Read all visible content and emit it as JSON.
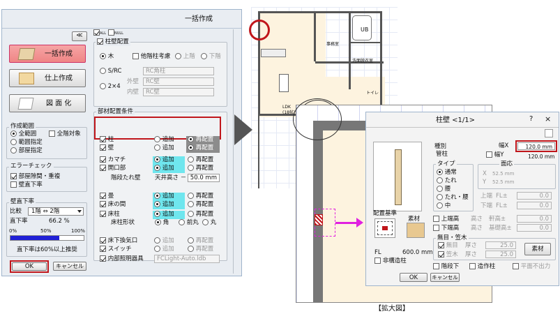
{
  "left": {
    "title": "一括作成",
    "collapse": "≪",
    "modes": [
      "一括作成",
      "仕上作成",
      "図 面 化"
    ],
    "tb_all": "ALL",
    "tb_none": "NULL",
    "range": {
      "title": "作成範囲",
      "all": "全範囲",
      "all_target": "全階対象",
      "area": "範囲指定",
      "floor": "部屋指定"
    },
    "error": {
      "title": "エラーチェック",
      "room": "部屋隙間・重複",
      "wall": "壁直下率"
    },
    "wall_rate": {
      "title": "壁直下率",
      "compare": "比較",
      "floor_pair": "1階 ⇔ 2階",
      "rate_label": "直下率",
      "rate_value": "66.2 %",
      "p0": "0%",
      "p50": "50%",
      "p100": "100%",
      "note": "直下率は60%以上推奨"
    },
    "ok": "OK",
    "cancel": "キャンセル",
    "pillar": {
      "title": "柱壁配置",
      "wood": "木",
      "srcc": "S/RC",
      "x24": "2×4",
      "other": "他階柱考慮",
      "up": "上階",
      "down": "下階",
      "srcc_sel": "RC角柱",
      "outer": "外壁",
      "outer_sel": "RC壁",
      "inner": "内壁",
      "inner_sel": "RC壁"
    },
    "parts": {
      "title": "部材配置条件",
      "add": "追加",
      "re": "再配置",
      "rows": [
        "柱",
        "壁",
        "カマチ",
        "開口部",
        "階段たれ壁",
        "畳",
        "床の間",
        "床柱",
        "床柱形状",
        "床下換気口",
        "スイッチ",
        "内部照明器具"
      ],
      "ceiling": "天井高さ －",
      "ceiling_val": "50.0 mm",
      "shape": [
        "角",
        "前丸",
        "丸"
      ],
      "light_sel": "FCLight-Auto.ldb"
    }
  },
  "plan": {
    "room_ub": "UB",
    "room_office": "事務室",
    "room_wash": "洗面脱衣室",
    "room_toilet": "トイレ",
    "room_ldk": "LDK",
    "room_ldk_sub": "(18帖)"
  },
  "dialog": {
    "title": "柱壁 <1/1>",
    "help": "?",
    "close": "×",
    "kind": "種別",
    "kind_val": "管柱",
    "width_x": "幅X",
    "width_x_val": "120.0 mm",
    "width_y": "幅Y",
    "width_y_val": "120.0 mm",
    "type": "タイプ",
    "types": [
      "通常",
      "たれ",
      "腰",
      "たれ・腰",
      "中"
    ],
    "chamfer": "面応",
    "cx": "X",
    "cx_val": "52.5 mm",
    "cy": "Y",
    "cy_val": "52.5 mm",
    "up_end": "上端",
    "down_end": "下端",
    "fl_pm": "FL±",
    "fl_val": "0.0",
    "up_high": "上端高",
    "down_high": "下端高",
    "high": "高さ",
    "eave": "軒高±",
    "base": "基礎高±",
    "fin": "無目・笠木",
    "fin_mu": "無目",
    "fin_ka": "笠木",
    "thick": "厚さ",
    "thick_val": "25.0",
    "material_btn": "素材",
    "place": "配置基準",
    "material": "素材",
    "fl_label": "FL",
    "fl_value": "600.0 mm",
    "non_struct": "非構造柱",
    "stair": "階段下",
    "structural": "造作柱",
    "plane": "平面不出力",
    "ok": "OK",
    "cancel": "キャンセル"
  },
  "caption": "【拡大図】"
}
